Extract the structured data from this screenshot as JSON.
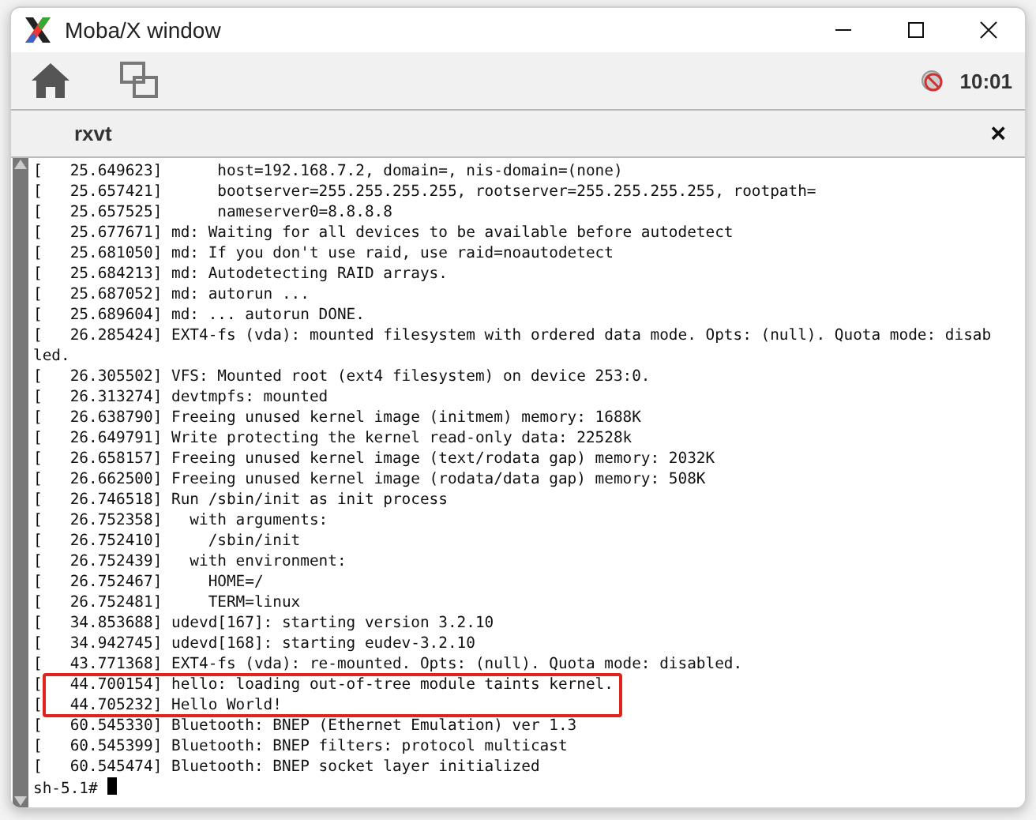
{
  "window": {
    "title": "Moba/X window"
  },
  "toolbar": {
    "clock": "10:01"
  },
  "tab": {
    "label": "rxvt",
    "close": "×"
  },
  "terminal": {
    "lines": [
      {
        "text": "[   25.649623]      host=192.168.7.2, domain=, nis-domain=(none)",
        "highlighted": false
      },
      {
        "text": "[   25.657421]      bootserver=255.255.255.255, rootserver=255.255.255.255, rootpath=",
        "highlighted": false
      },
      {
        "text": "[   25.657525]      nameserver0=8.8.8.8",
        "highlighted": false
      },
      {
        "text": "[   25.677671] md: Waiting for all devices to be available before autodetect",
        "highlighted": false
      },
      {
        "text": "[   25.681050] md: If you don't use raid, use raid=noautodetect",
        "highlighted": false
      },
      {
        "text": "[   25.684213] md: Autodetecting RAID arrays.",
        "highlighted": false
      },
      {
        "text": "[   25.687052] md: autorun ...",
        "highlighted": false
      },
      {
        "text": "[   25.689604] md: ... autorun DONE.",
        "highlighted": false
      },
      {
        "text": "[   26.285424] EXT4-fs (vda): mounted filesystem with ordered data mode. Opts: (null). Quota mode: disab",
        "highlighted": false
      },
      {
        "text": "led.",
        "highlighted": false
      },
      {
        "text": "[   26.305502] VFS: Mounted root (ext4 filesystem) on device 253:0.",
        "highlighted": false
      },
      {
        "text": "[   26.313274] devtmpfs: mounted",
        "highlighted": false
      },
      {
        "text": "[   26.638790] Freeing unused kernel image (initmem) memory: 1688K",
        "highlighted": false
      },
      {
        "text": "[   26.649791] Write protecting the kernel read-only data: 22528k",
        "highlighted": false
      },
      {
        "text": "[   26.658157] Freeing unused kernel image (text/rodata gap) memory: 2032K",
        "highlighted": false
      },
      {
        "text": "[   26.662500] Freeing unused kernel image (rodata/data gap) memory: 508K",
        "highlighted": false
      },
      {
        "text": "[   26.746518] Run /sbin/init as init process",
        "highlighted": false
      },
      {
        "text": "[   26.752358]   with arguments:",
        "highlighted": false
      },
      {
        "text": "[   26.752410]     /sbin/init",
        "highlighted": false
      },
      {
        "text": "[   26.752439]   with environment:",
        "highlighted": false
      },
      {
        "text": "[   26.752467]     HOME=/",
        "highlighted": false
      },
      {
        "text": "[   26.752481]     TERM=linux",
        "highlighted": false
      },
      {
        "text": "[   34.853688] udevd[167]: starting version 3.2.10",
        "highlighted": false
      },
      {
        "text": "[   34.942745] udevd[168]: starting eudev-3.2.10",
        "highlighted": false
      },
      {
        "text": "[   43.771368] EXT4-fs (vda): re-mounted. Opts: (null). Quota mode: disabled.",
        "highlighted": false
      },
      {
        "text": "[   44.700154] hello: loading out-of-tree module taints kernel.",
        "highlighted": true
      },
      {
        "text": "[   44.705232] Hello World!",
        "highlighted": true
      },
      {
        "text": "[   60.545330] Bluetooth: BNEP (Ethernet Emulation) ver 1.3",
        "highlighted": false
      },
      {
        "text": "[   60.545399] Bluetooth: BNEP filters: protocol multicast",
        "highlighted": false
      },
      {
        "text": "[   60.545474] Bluetooth: BNEP socket layer initialized",
        "highlighted": false
      }
    ],
    "prompt": "sh-5.1# "
  }
}
